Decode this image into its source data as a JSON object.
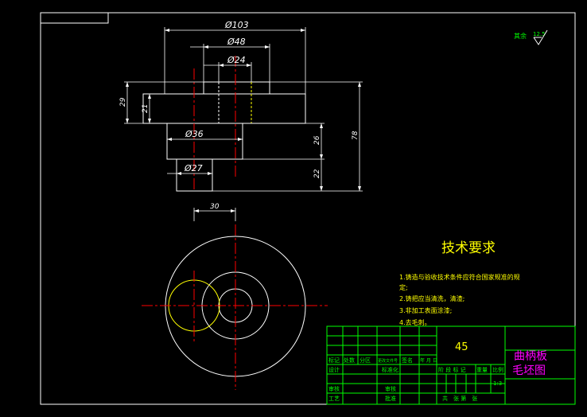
{
  "colors": {
    "background": "#000000",
    "outline": "#ffffff",
    "centerline": "#ff0000",
    "hidden": "#ffff00",
    "titleblock": "#00ff00",
    "text_yellow": "#ffff00",
    "title_magenta": "#ff00ff"
  },
  "roughness": {
    "label": "其余",
    "value": "12.5"
  },
  "dimensions": {
    "d103": "Ø103",
    "d48": "Ø48",
    "d24": "Ø24",
    "d36": "Ø36",
    "d27": "Ø27",
    "h29": "29",
    "h21": "21",
    "h26": "26",
    "h22": "22",
    "h78": "78",
    "off30": "30"
  },
  "tech_req": {
    "title": "技术要求",
    "lines": [
      "1.铸造与验收技术条件应符合国家规准的规",
      "定;",
      "2.铸把应当清洗，清渣;",
      "3.非加工表面涂漆;",
      "4.去毛刺。"
    ]
  },
  "title_block": {
    "material": "45",
    "part_name_1": "曲柄板",
    "part_name_2": "毛坯图",
    "header_cells": [
      "标记",
      "处数",
      "分区",
      "更改文件号",
      "签名",
      "年 月 日"
    ],
    "row_labels": [
      "设计",
      "审核",
      "工艺"
    ],
    "mid_labels": [
      "标准化",
      "",
      "审核",
      "批准"
    ],
    "scale_headers": [
      "阶 段 标 记",
      "重量",
      "比例"
    ],
    "scale_value": "1:3",
    "sheet_text": "共　张  第　张"
  }
}
